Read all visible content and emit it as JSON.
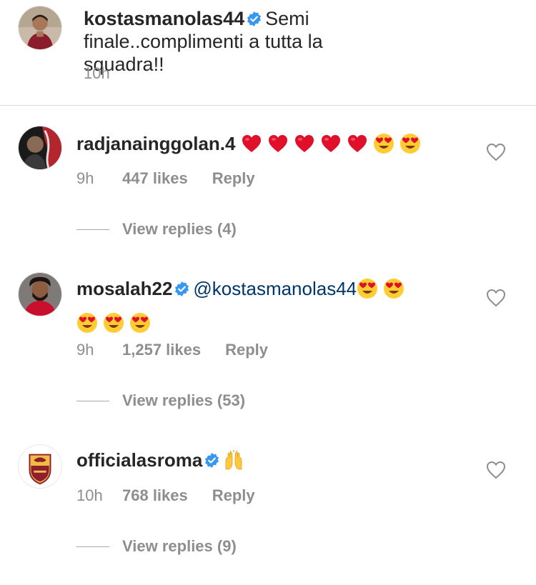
{
  "post": {
    "username": "kostasmanolas44",
    "caption": "Semi finale..complimenti a tutta la squadra!!",
    "time": "10h"
  },
  "comments": [
    {
      "username": "radjanainggolan.4",
      "verified": false,
      "emojis": [
        "red-heart",
        "red-heart",
        "red-heart",
        "red-heart",
        "red-heart",
        "heart-eyes",
        "heart-eyes"
      ],
      "time": "9h",
      "likes": "447 likes",
      "reply_label": "Reply",
      "view_replies": "View replies (4)"
    },
    {
      "username": "mosalah22",
      "verified": true,
      "mention": "@kostasmanolas44",
      "emojis": [
        "heart-eyes",
        "heart-eyes",
        "heart-eyes",
        "heart-eyes",
        "heart-eyes"
      ],
      "time": "9h",
      "likes": "1,257 likes",
      "reply_label": "Reply",
      "view_replies": "View replies (53)"
    },
    {
      "username": "officialasroma",
      "verified": true,
      "emojis": [
        "raised-hands"
      ],
      "time": "10h",
      "likes": "768 likes",
      "reply_label": "Reply",
      "view_replies": "View replies (9)"
    }
  ],
  "colors": {
    "text": "#262626",
    "secondary": "#8e8e8e",
    "verified": "#3897f0",
    "mention": "#003569",
    "divider": "#dbdbdb",
    "heart_emoji": "#e0102b"
  },
  "icons": {
    "verified": "verified-badge-icon",
    "like": "heart-outline-icon"
  }
}
